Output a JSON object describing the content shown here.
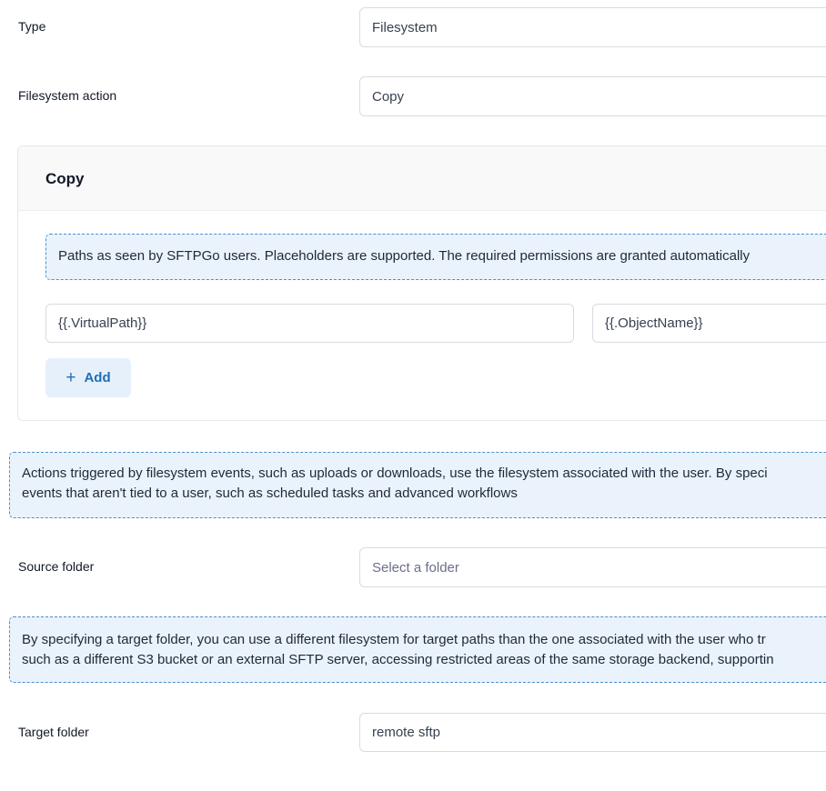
{
  "type_row": {
    "label": "Type",
    "value": "Filesystem"
  },
  "action_row": {
    "label": "Filesystem action",
    "value": "Copy"
  },
  "copy_card": {
    "title": "Copy",
    "notice": "Paths as seen by SFTPGo users. Placeholders are supported. The required permissions are granted automatically",
    "source_path": "{{.VirtualPath}}",
    "target_path": "{{.ObjectName}}",
    "add_label": "Add",
    "add_icon": "plus-icon"
  },
  "fs_notice": {
    "line1": "Actions triggered by filesystem events, such as uploads or downloads, use the filesystem associated with the user. By speci",
    "line2": "events that aren't tied to a user, such as scheduled tasks and advanced workflows"
  },
  "source_folder": {
    "label": "Source folder",
    "placeholder": "Select a folder"
  },
  "target_notice": {
    "line1": "By specifying a target folder, you can use a different filesystem for target paths than the one associated with the user who tr",
    "line2": "such as a different S3 bucket or an external SFTP server, accessing restricted areas of the same storage backend, supportin"
  },
  "target_folder": {
    "label": "Target folder",
    "value": "remote sftp"
  },
  "colors": {
    "accent": "#1e6fb8",
    "notice_bg": "#eaf3fc",
    "notice_border": "#4a8ecf"
  }
}
